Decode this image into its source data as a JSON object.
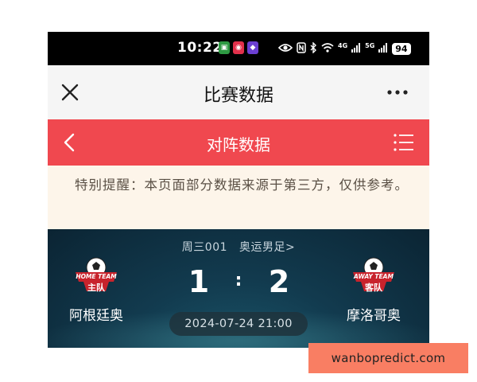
{
  "status_bar": {
    "time": "10:22",
    "battery": "94",
    "net_4g": "4G",
    "net_5g": "5G"
  },
  "title_bar": {
    "title": "比赛数据"
  },
  "header": {
    "title": "对阵数据"
  },
  "notice": {
    "text": "特别提醒：本页面部分数据来源于第三方，仅供参考。"
  },
  "match": {
    "match_no": "周三001",
    "league": "奥运男足>",
    "home": {
      "badge_line1": "HOME TEAM",
      "badge_line2": "主队",
      "name": "阿根廷奥",
      "score": "1"
    },
    "away": {
      "badge_line1": "AWAY TEAM",
      "badge_line2": "客队",
      "name": "摩洛哥奥",
      "score": "2"
    },
    "separator": ":",
    "datetime": "2024-07-24 21:00"
  },
  "watermark": {
    "text": "wanbopredict.com"
  },
  "colors": {
    "header_red": "#f0484f",
    "notice_bg": "#fdf5ea",
    "badge_red": "#c8232c",
    "watermark_bg": "#f97e63"
  }
}
